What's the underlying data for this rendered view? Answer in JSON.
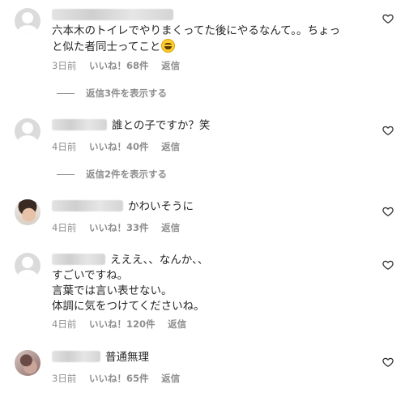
{
  "comments": [
    {
      "avatar": "default-avatar",
      "text_line1": "六本木のトイレでやりまくってた後にやるなんて。。ちょっ",
      "text_line2": "と似た者同士ってこと",
      "emoji": "grinning-sweat-emoji",
      "time": "3日前",
      "likes": "いいね！68件",
      "reply": "返信",
      "view_replies": "返信3件を表示する"
    },
    {
      "avatar": "default-avatar",
      "text": "誰との子ですか？笑",
      "time": "4日前",
      "likes": "いいね！40件",
      "reply": "返信",
      "view_replies": "返信2件を表示する"
    },
    {
      "avatar": "photo-avatar",
      "text": "かわいそうに",
      "time": "4日前",
      "likes": "いいね！33件",
      "reply": "返信"
    },
    {
      "avatar": "default-avatar",
      "lines": [
        "えええ、、なんか、、",
        "すごいですね。",
        "言葉では言い表せない。",
        "体調に気をつけてくださいね。"
      ],
      "time": "4日前",
      "likes": "いいね！120件",
      "reply": "返信"
    },
    {
      "avatar": "photo-avatar",
      "text": "普通無理",
      "time": "3日前",
      "likes": "いいね！65件",
      "reply": "返信"
    }
  ],
  "icons": {
    "like": "heart-outline-icon"
  },
  "colors": {
    "text": "#262626",
    "meta": "#8e8e8e"
  }
}
